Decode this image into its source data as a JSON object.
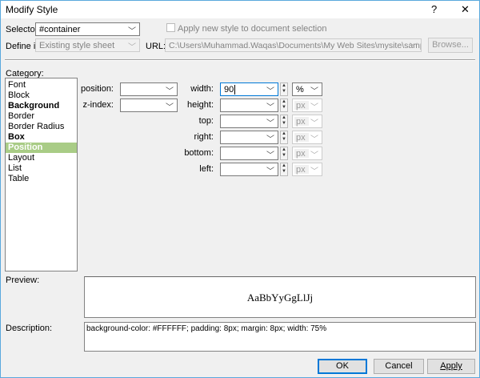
{
  "window": {
    "title": "Modify Style",
    "help": "?",
    "close": "✕"
  },
  "selector": {
    "label": "Selector:",
    "value": "#container"
  },
  "apply_checkbox": {
    "label": "Apply new style to document selection",
    "checked": false
  },
  "define_in": {
    "label": "Define in:",
    "value": "Existing style sheet"
  },
  "url": {
    "label": "URL:",
    "value": "C:\\Users\\Muhammad.Waqas\\Documents\\My Web Sites\\mysite\\sample.css"
  },
  "browse_label": "Browse...",
  "category": {
    "label": "Category:",
    "items": [
      {
        "label": "Font",
        "bold": false
      },
      {
        "label": "Block",
        "bold": false
      },
      {
        "label": "Background",
        "bold": true
      },
      {
        "label": "Border",
        "bold": false
      },
      {
        "label": "Border Radius",
        "bold": false
      },
      {
        "label": "Box",
        "bold": true
      },
      {
        "label": "Position",
        "bold": true,
        "selected": true
      },
      {
        "label": "Layout",
        "bold": false
      },
      {
        "label": "List",
        "bold": false
      },
      {
        "label": "Table",
        "bold": false
      }
    ],
    "selected_color": "#a9cc86"
  },
  "position_fields": [
    {
      "label": "position:",
      "value": ""
    },
    {
      "label": "z-index:",
      "value": ""
    }
  ],
  "dimension_fields": [
    {
      "label": "width:",
      "value": "90",
      "unit": "%",
      "unit_enabled": true
    },
    {
      "label": "height:",
      "value": "",
      "unit": "px",
      "unit_enabled": false
    },
    {
      "label": "top:",
      "value": "",
      "unit": "px",
      "unit_enabled": false
    },
    {
      "label": "right:",
      "value": "",
      "unit": "px",
      "unit_enabled": false
    },
    {
      "label": "bottom:",
      "value": "",
      "unit": "px",
      "unit_enabled": false
    },
    {
      "label": "left:",
      "value": "",
      "unit": "px",
      "unit_enabled": false
    }
  ],
  "preview": {
    "label": "Preview:",
    "text": "AaBbYyGgLlJj"
  },
  "description": {
    "label": "Description:",
    "text": "background-color: #FFFFFF; padding: 8px; margin: 8px; width: 75%"
  },
  "buttons": {
    "ok": "OK",
    "cancel": "Cancel",
    "apply": "Apply"
  }
}
